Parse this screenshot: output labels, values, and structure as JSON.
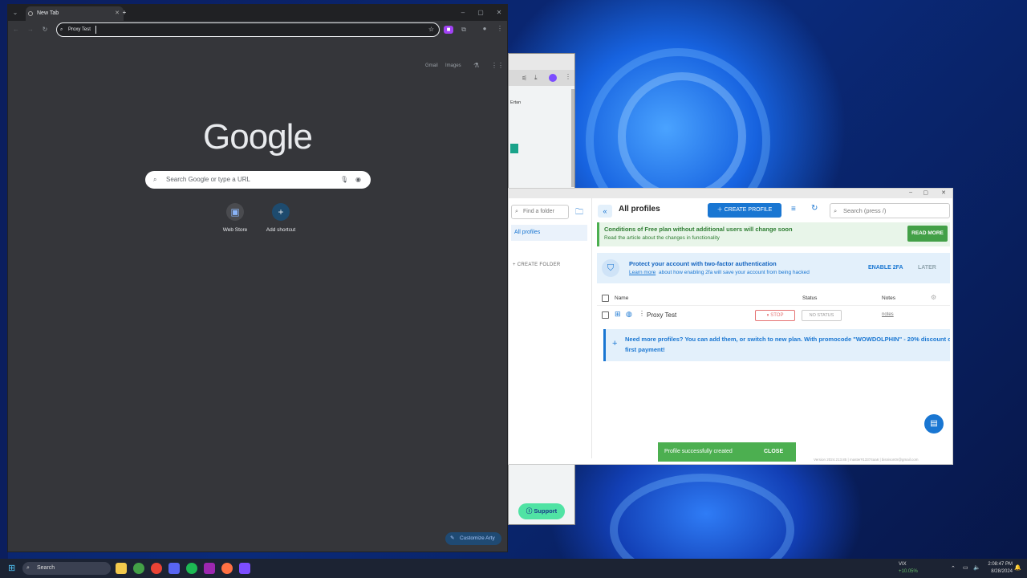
{
  "chrome": {
    "tab_title": "New Tab",
    "omnibox_value": "Proxy Test",
    "top_links": [
      "Gmail",
      "Images"
    ],
    "logo_text": "Google",
    "search_placeholder": "Search Google or type a URL",
    "shortcuts": [
      {
        "label": "Web Store",
        "icon": "web-store-icon"
      },
      {
        "label": "Add shortcut",
        "icon": "plus-icon"
      }
    ],
    "customize_label": "Customize Arty"
  },
  "background_window": {
    "dropdown_text": "Ertan",
    "support_label": "Support"
  },
  "arty": {
    "title": "All profiles",
    "folder_search_placeholder": "Find a folder",
    "sidebar_item": "All profiles",
    "create_folder": "+ CREATE FOLDER",
    "create_profile_label": "CREATE PROFILE",
    "search_placeholder": "Search (press /)",
    "conditions_title": "Conditions of Free plan without additional users will change soon",
    "conditions_subtitle": "Read the article about the changes in functionality",
    "read_more": "READ MORE",
    "twofa_title": "Protect your account with two-factor authentication",
    "twofa_link": "Learn more",
    "twofa_rest": "about how enabling 2fa will save your account from being hacked",
    "enable_2fa": "ENABLE 2FA",
    "later": "LATER",
    "columns": {
      "name": "Name",
      "status": "Status",
      "notes": "Notes"
    },
    "profile": {
      "name": "Proxy Test",
      "stop": "STOP",
      "status": "NO STATUS",
      "notes": "notes"
    },
    "need_more_line1": "Need more profiles? You can add them, or switch to new plan. With promocode \"WOWDOLPHIN\" - 20% discount o",
    "need_more_line2": "first payment!",
    "toast_message": "Profile successfully created",
    "toast_close": "CLOSE",
    "footer": "Version 2024.213.85   |   master#13374aa6   |   bisnison0r@gmail.com"
  },
  "taskbar": {
    "search_label": "Search",
    "ticker_name": "VIX",
    "ticker_change": "+10.05%",
    "time": "2:08:47 PM",
    "date": "8/28/2024"
  },
  "colors": {
    "accent_blue": "#1976d2",
    "green": "#4caf50",
    "chrome_dark": "#35363a"
  }
}
